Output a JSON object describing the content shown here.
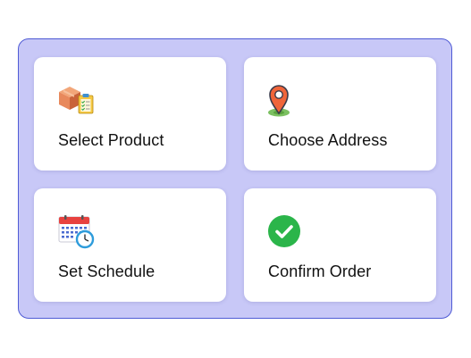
{
  "cards": [
    {
      "label": "Select Product",
      "icon": "box-checklist-icon"
    },
    {
      "label": "Choose Address",
      "icon": "location-pin-icon"
    },
    {
      "label": "Set Schedule",
      "icon": "calendar-clock-icon"
    },
    {
      "label": "Confirm Order",
      "icon": "checkmark-circle-icon"
    }
  ],
  "colors": {
    "panel_background": "#c8c8f7",
    "panel_border": "#4f5bd5",
    "card_background": "#ffffff",
    "check_green": "#2bb54a",
    "pin_orange": "#f0653a",
    "pin_dark": "#3a3a4a",
    "box_orange": "#e8895c",
    "calendar_red": "#e8423f",
    "clock_blue": "#2e9cdb"
  }
}
